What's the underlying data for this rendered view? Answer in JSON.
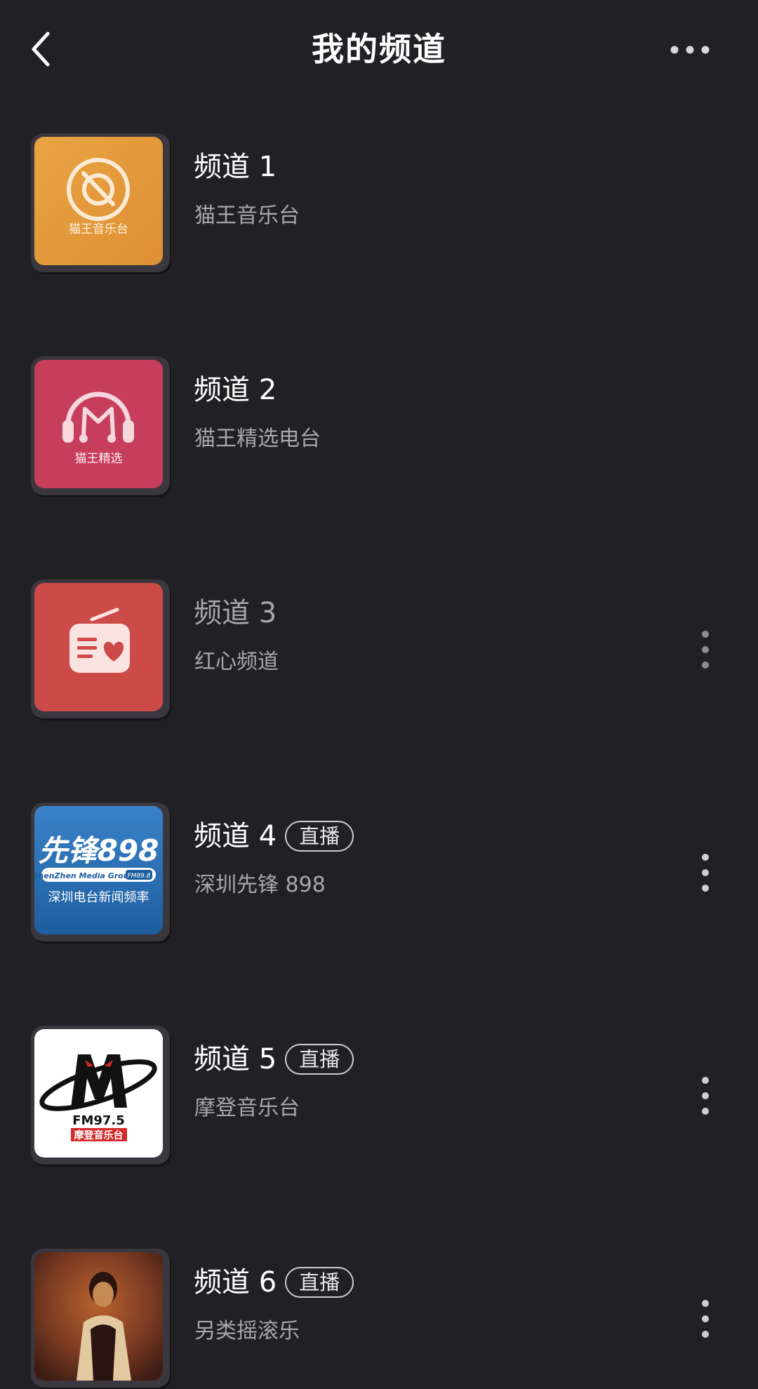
{
  "header": {
    "title": "我的频道",
    "back_icon": "chevron-left-icon",
    "more_icon": "more-horizontal-icon"
  },
  "channels": [
    {
      "title": "频道 1",
      "subtitle": "猫王音乐台",
      "badge": "",
      "cover_text": "猫王音乐台",
      "cover_color": "#E59D3C",
      "dimmed": false,
      "has_menu": false
    },
    {
      "title": "频道 2",
      "subtitle": "猫王精选电台",
      "badge": "",
      "cover_text": "猫王精选",
      "cover_color": "#C73E5C",
      "dimmed": false,
      "has_menu": false
    },
    {
      "title": "频道 3",
      "subtitle": "红心频道",
      "badge": "",
      "cover_text": "",
      "cover_color": "#CC4A48",
      "dimmed": true,
      "has_menu": true
    },
    {
      "title": "频道 4",
      "subtitle": "深圳先锋 898",
      "badge": "直播",
      "cover_text": "先锋898",
      "cover_text_2": "ShenZhen Media Group",
      "cover_text_3": "FM89.8",
      "cover_text_4": "深圳电台新闻频率",
      "cover_color": "#2C6FB3",
      "dimmed": false,
      "has_menu": true
    },
    {
      "title": "频道 5",
      "subtitle": "摩登音乐台",
      "badge": "直播",
      "cover_text": "FM97.5",
      "cover_text_2": "摩登音乐台",
      "cover_color": "#FFFFFF",
      "dimmed": false,
      "has_menu": true
    },
    {
      "title": "频道 6",
      "subtitle": "另类摇滚乐",
      "badge": "直播",
      "cover_text": "",
      "cover_color": "#7A3A22",
      "dimmed": false,
      "has_menu": true
    }
  ]
}
